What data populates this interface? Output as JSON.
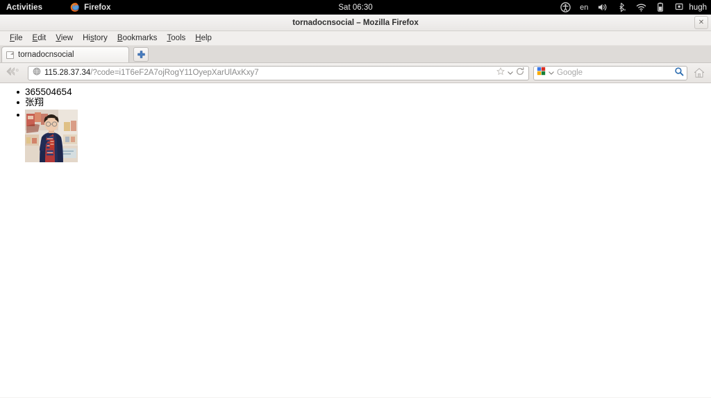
{
  "desktop": {
    "activities_label": "Activities",
    "app_name": "Firefox",
    "clock": "Sat 06:30",
    "tray": {
      "accessibility_icon": "accessibility-icon",
      "keyboard_layout": "en",
      "volume_icon": "volume-icon",
      "bluetooth_icon": "bluetooth-disabled-icon",
      "wifi_icon": "wifi-icon",
      "battery_icon": "battery-icon",
      "user_icon": "user-icon",
      "user_name": "hugh"
    }
  },
  "window": {
    "title": "tornadocnsocial – Mozilla Firefox",
    "close_label": "✕"
  },
  "menubar": {
    "items": [
      {
        "label": "File",
        "mnemonic": "F"
      },
      {
        "label": "Edit",
        "mnemonic": "E"
      },
      {
        "label": "View",
        "mnemonic": "V"
      },
      {
        "label": "History",
        "mnemonic": "s"
      },
      {
        "label": "Bookmarks",
        "mnemonic": "B"
      },
      {
        "label": "Tools",
        "mnemonic": "T"
      },
      {
        "label": "Help",
        "mnemonic": "H"
      }
    ]
  },
  "tabs": {
    "items": [
      {
        "label": "tornadocnsocial",
        "favicon": "page-icon",
        "active": true
      }
    ],
    "new_tab_label": "+"
  },
  "navbar": {
    "back_icon": "back-arrow-icon",
    "forward_icon": "forward-arrow-icon",
    "site_icon": "globe-icon",
    "url_host": "115.28.37.34",
    "url_path": "/?code=i1T6eF2A7ojRogY11OyepXarUlAxKxy7",
    "bookmark_icon": "star-icon",
    "bookmark_dropdown_icon": "chevron-down-icon",
    "reload_icon": "reload-icon",
    "search_engine_icon": "google-icon",
    "search_engine_dropdown_icon": "chevron-down-icon",
    "search_placeholder": "Google",
    "search_go_icon": "magnifier-icon",
    "home_icon": "home-icon"
  },
  "page": {
    "items": [
      {
        "type": "text",
        "value": "365504654"
      },
      {
        "type": "text",
        "value": "张翔"
      },
      {
        "type": "image",
        "alt": "profile-photo"
      }
    ]
  },
  "colors": {
    "accent_blue": "#3b76c4",
    "topbar_black": "#000000",
    "chrome_grey": "#e7e4e1",
    "page_white": "#ffffff"
  }
}
